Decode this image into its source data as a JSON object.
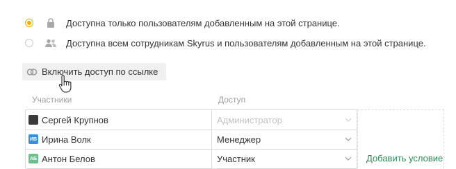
{
  "access_options": [
    {
      "label": "Доступна только пользователям добавленным на этой странице.",
      "checked": true,
      "icon": "lock-icon"
    },
    {
      "label": "Доступна всем сотрудникам Skyrus и пользователям добавленным на этой странице.",
      "checked": false,
      "icon": "users-icon"
    }
  ],
  "link_access": {
    "label": "Включить доступ по ссылке",
    "icon": "link-icon"
  },
  "table": {
    "col_participants": "Участники",
    "col_access": "Доступ",
    "rows": [
      {
        "avatar": "",
        "avatar_color": "#3a3a3a",
        "name": "Сергей Крупнов",
        "access": "Администратор",
        "disabled": true
      },
      {
        "avatar": "ИВ",
        "avatar_color": "#3b8fd9",
        "name": "Ирина Волк",
        "access": "Менеджер",
        "disabled": false
      },
      {
        "avatar": "АБ",
        "avatar_color": "#6cc08b",
        "name": "Антон Белов",
        "access": "Участник",
        "disabled": false
      }
    ]
  },
  "add_condition": "Добавить условие",
  "colors": {
    "accent": "#e5b400",
    "link": "#2e8b57"
  }
}
